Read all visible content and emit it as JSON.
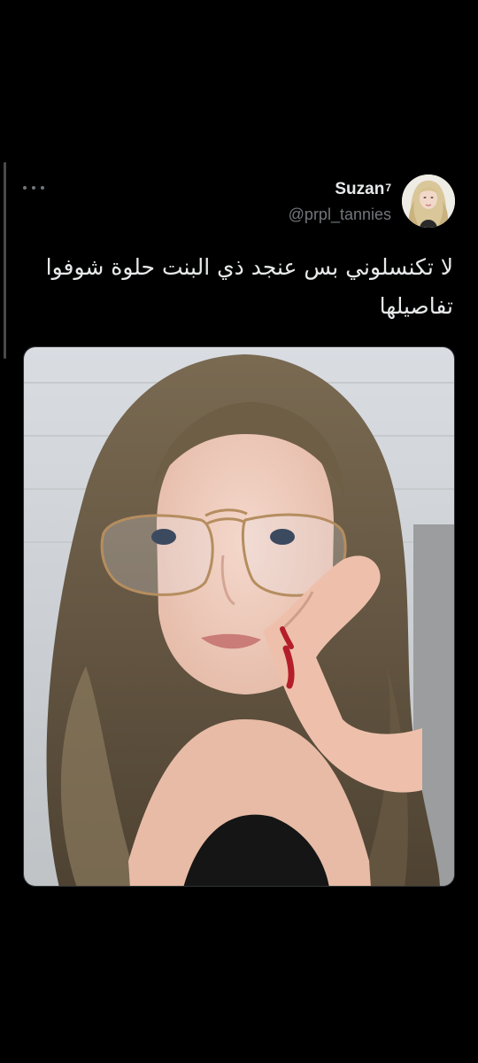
{
  "tweet": {
    "author": {
      "display_name": "Suzan",
      "name_suffix": "7",
      "handle": "@prpl_tannies",
      "avatar_icon": "profile-avatar"
    },
    "text": "لا تكنسلوني بس عنجد ذي البنت حلوة شوفوا تفاصيلها",
    "more_icon": "more-horizontal-icon",
    "media": {
      "type": "photo",
      "icon": "selfie-photo"
    }
  },
  "colors": {
    "background": "#000000",
    "primary_text": "#e7e9ea",
    "secondary_text": "#71767b",
    "border": "#2f3336"
  }
}
